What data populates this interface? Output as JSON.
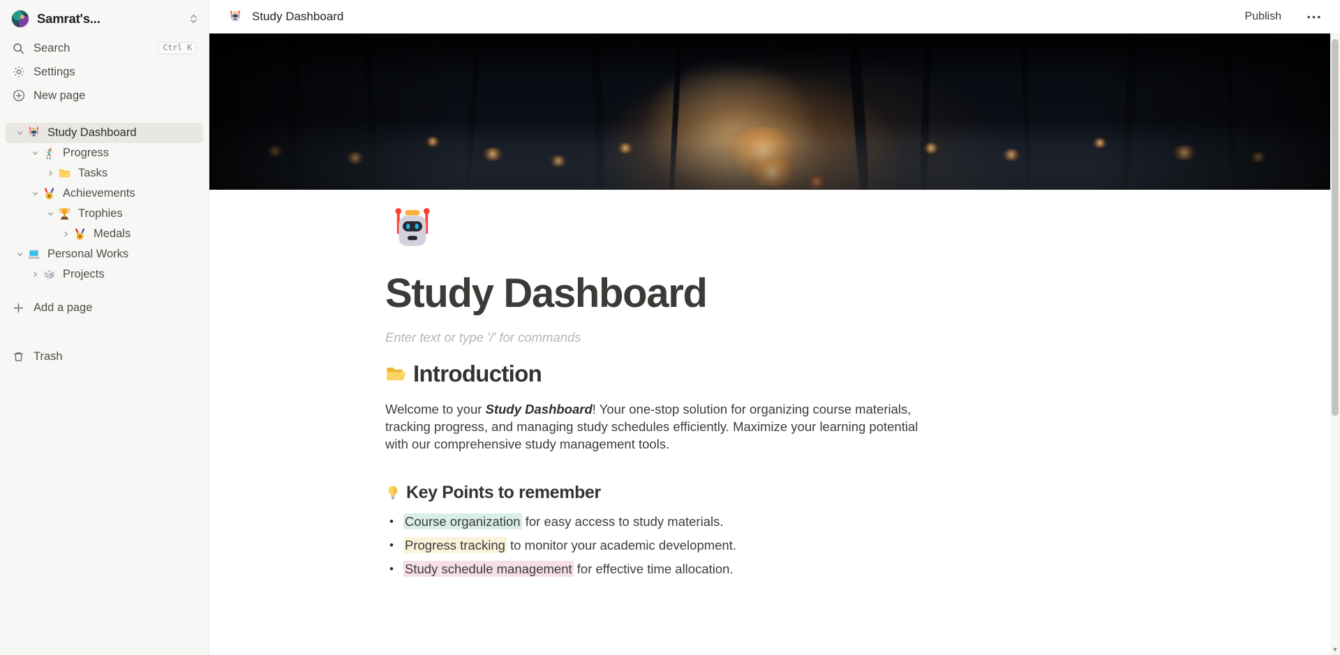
{
  "workspace": {
    "name": "Samrat's...",
    "avatar_icon": "user-avatar"
  },
  "sidebar": {
    "nav": [
      {
        "label": "Search",
        "icon": "search-icon",
        "shortcut": "Ctrl K"
      },
      {
        "label": "Settings",
        "icon": "gear-icon",
        "shortcut": ""
      },
      {
        "label": "New page",
        "icon": "plus-circle-icon",
        "shortcut": ""
      }
    ],
    "tree": [
      {
        "label": "Study Dashboard",
        "emoji": "robot-emoji",
        "indent": 0,
        "twisty": "chevron-down-icon",
        "active": true
      },
      {
        "label": "Progress",
        "emoji": "runner-emoji",
        "indent": 1,
        "twisty": "chevron-down-icon",
        "active": false
      },
      {
        "label": "Tasks",
        "emoji": "folder-emoji",
        "indent": 2,
        "twisty": "chevron-right-icon",
        "active": false
      },
      {
        "label": "Achievements",
        "emoji": "medal-emoji",
        "indent": 1,
        "twisty": "chevron-down-icon",
        "active": false
      },
      {
        "label": "Trophies",
        "emoji": "trophy-emoji",
        "indent": 2,
        "twisty": "chevron-down-icon",
        "active": false
      },
      {
        "label": "Medals",
        "emoji": "medal-emoji",
        "indent": 3,
        "twisty": "chevron-right-icon",
        "active": false
      },
      {
        "label": "Personal Works",
        "emoji": "laptop-emoji",
        "indent": 1,
        "twisty": "chevron-down-icon",
        "active": false
      },
      {
        "label": "Projects",
        "emoji": "dice-emoji",
        "indent": 2,
        "twisty": "chevron-right-icon",
        "active": false
      }
    ],
    "add_page": {
      "label": "Add a page",
      "icon": "plus-icon"
    },
    "trash": {
      "label": "Trash",
      "icon": "trash-icon"
    }
  },
  "topbar": {
    "emoji": "robot-emoji",
    "title": "Study Dashboard",
    "publish_label": "Publish",
    "more_icon": "ellipsis-icon"
  },
  "page": {
    "icon": "robot-emoji",
    "title": "Study Dashboard",
    "placeholder": "Enter text or type '/' for commands",
    "sections": [
      {
        "heading_emoji": "open-folder-emoji",
        "heading": "Introduction",
        "paragraph_pre": "Welcome to your ",
        "paragraph_strong": "Study Dashboard",
        "paragraph_post": "! Your one-stop solution for organizing course materials, tracking progress, and managing study schedules efficiently. Maximize your learning potential with our comprehensive study management tools."
      }
    ],
    "key_points": {
      "heading_emoji": "light-bulb-emoji",
      "heading": "Key Points to remember",
      "items": [
        {
          "highlight": "Course organization",
          "rest": " for easy access to study materials.",
          "color": "#daeee7"
        },
        {
          "highlight": "Progress tracking",
          "rest": " to monitor your academic development.",
          "color": "#fbf2da"
        },
        {
          "highlight": "Study schedule management",
          "rest": " for effective time allocation.",
          "color": "#f7dfe9"
        }
      ]
    }
  },
  "colors": {
    "sidebar_bg": "#f7f7f5",
    "active_row": "#e8e7e4",
    "text_primary": "#3d3c39",
    "text_muted": "#85847f"
  }
}
